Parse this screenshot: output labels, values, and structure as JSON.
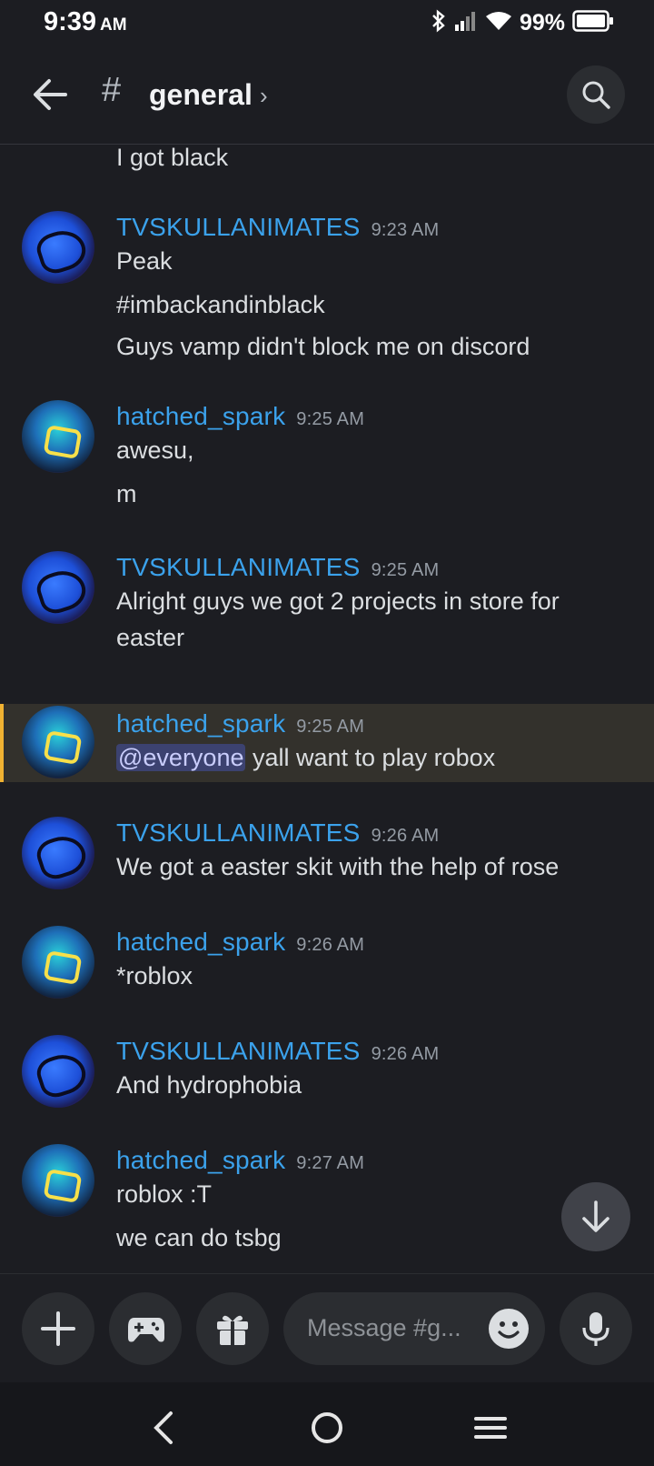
{
  "status": {
    "time": "9:39",
    "ampm": "AM",
    "battery": "99%"
  },
  "header": {
    "hash": "#",
    "channel": "general",
    "chevron": "›"
  },
  "messages": [
    {
      "author": "",
      "time": "",
      "lines": [
        "I got black"
      ]
    },
    {
      "author": "TVSKULLANIMATES",
      "time": "9:23 AM",
      "lines": [
        "Peak",
        "#imbackandinblack",
        "Guys vamp didn't block me on discord"
      ]
    },
    {
      "author": "hatched_spark",
      "time": "9:25 AM",
      "lines": [
        "awesu,",
        "m"
      ]
    },
    {
      "author": "TVSKULLANIMATES",
      "time": "9:25 AM",
      "lines": [
        "Alright guys we got 2 projects in store for",
        "easter"
      ]
    },
    {
      "author": "hatched_spark",
      "time": "9:25 AM",
      "mention": "@everyone",
      "lines": [
        " yall want to play robox"
      ]
    },
    {
      "author": "TVSKULLANIMATES",
      "time": "9:26 AM",
      "lines": [
        "We got a easter skit with the help of rose"
      ]
    },
    {
      "author": "hatched_spark",
      "time": "9:26 AM",
      "lines": [
        "*roblox"
      ]
    },
    {
      "author": "TVSKULLANIMATES",
      "time": "9:26 AM",
      "lines": [
        "And hydrophobia"
      ]
    },
    {
      "author": "hatched_spark",
      "time": "9:27 AM",
      "lines": [
        "roblox :T",
        "we can do tsbg"
      ]
    }
  ],
  "composer": {
    "placeholder": "Message #g..."
  }
}
